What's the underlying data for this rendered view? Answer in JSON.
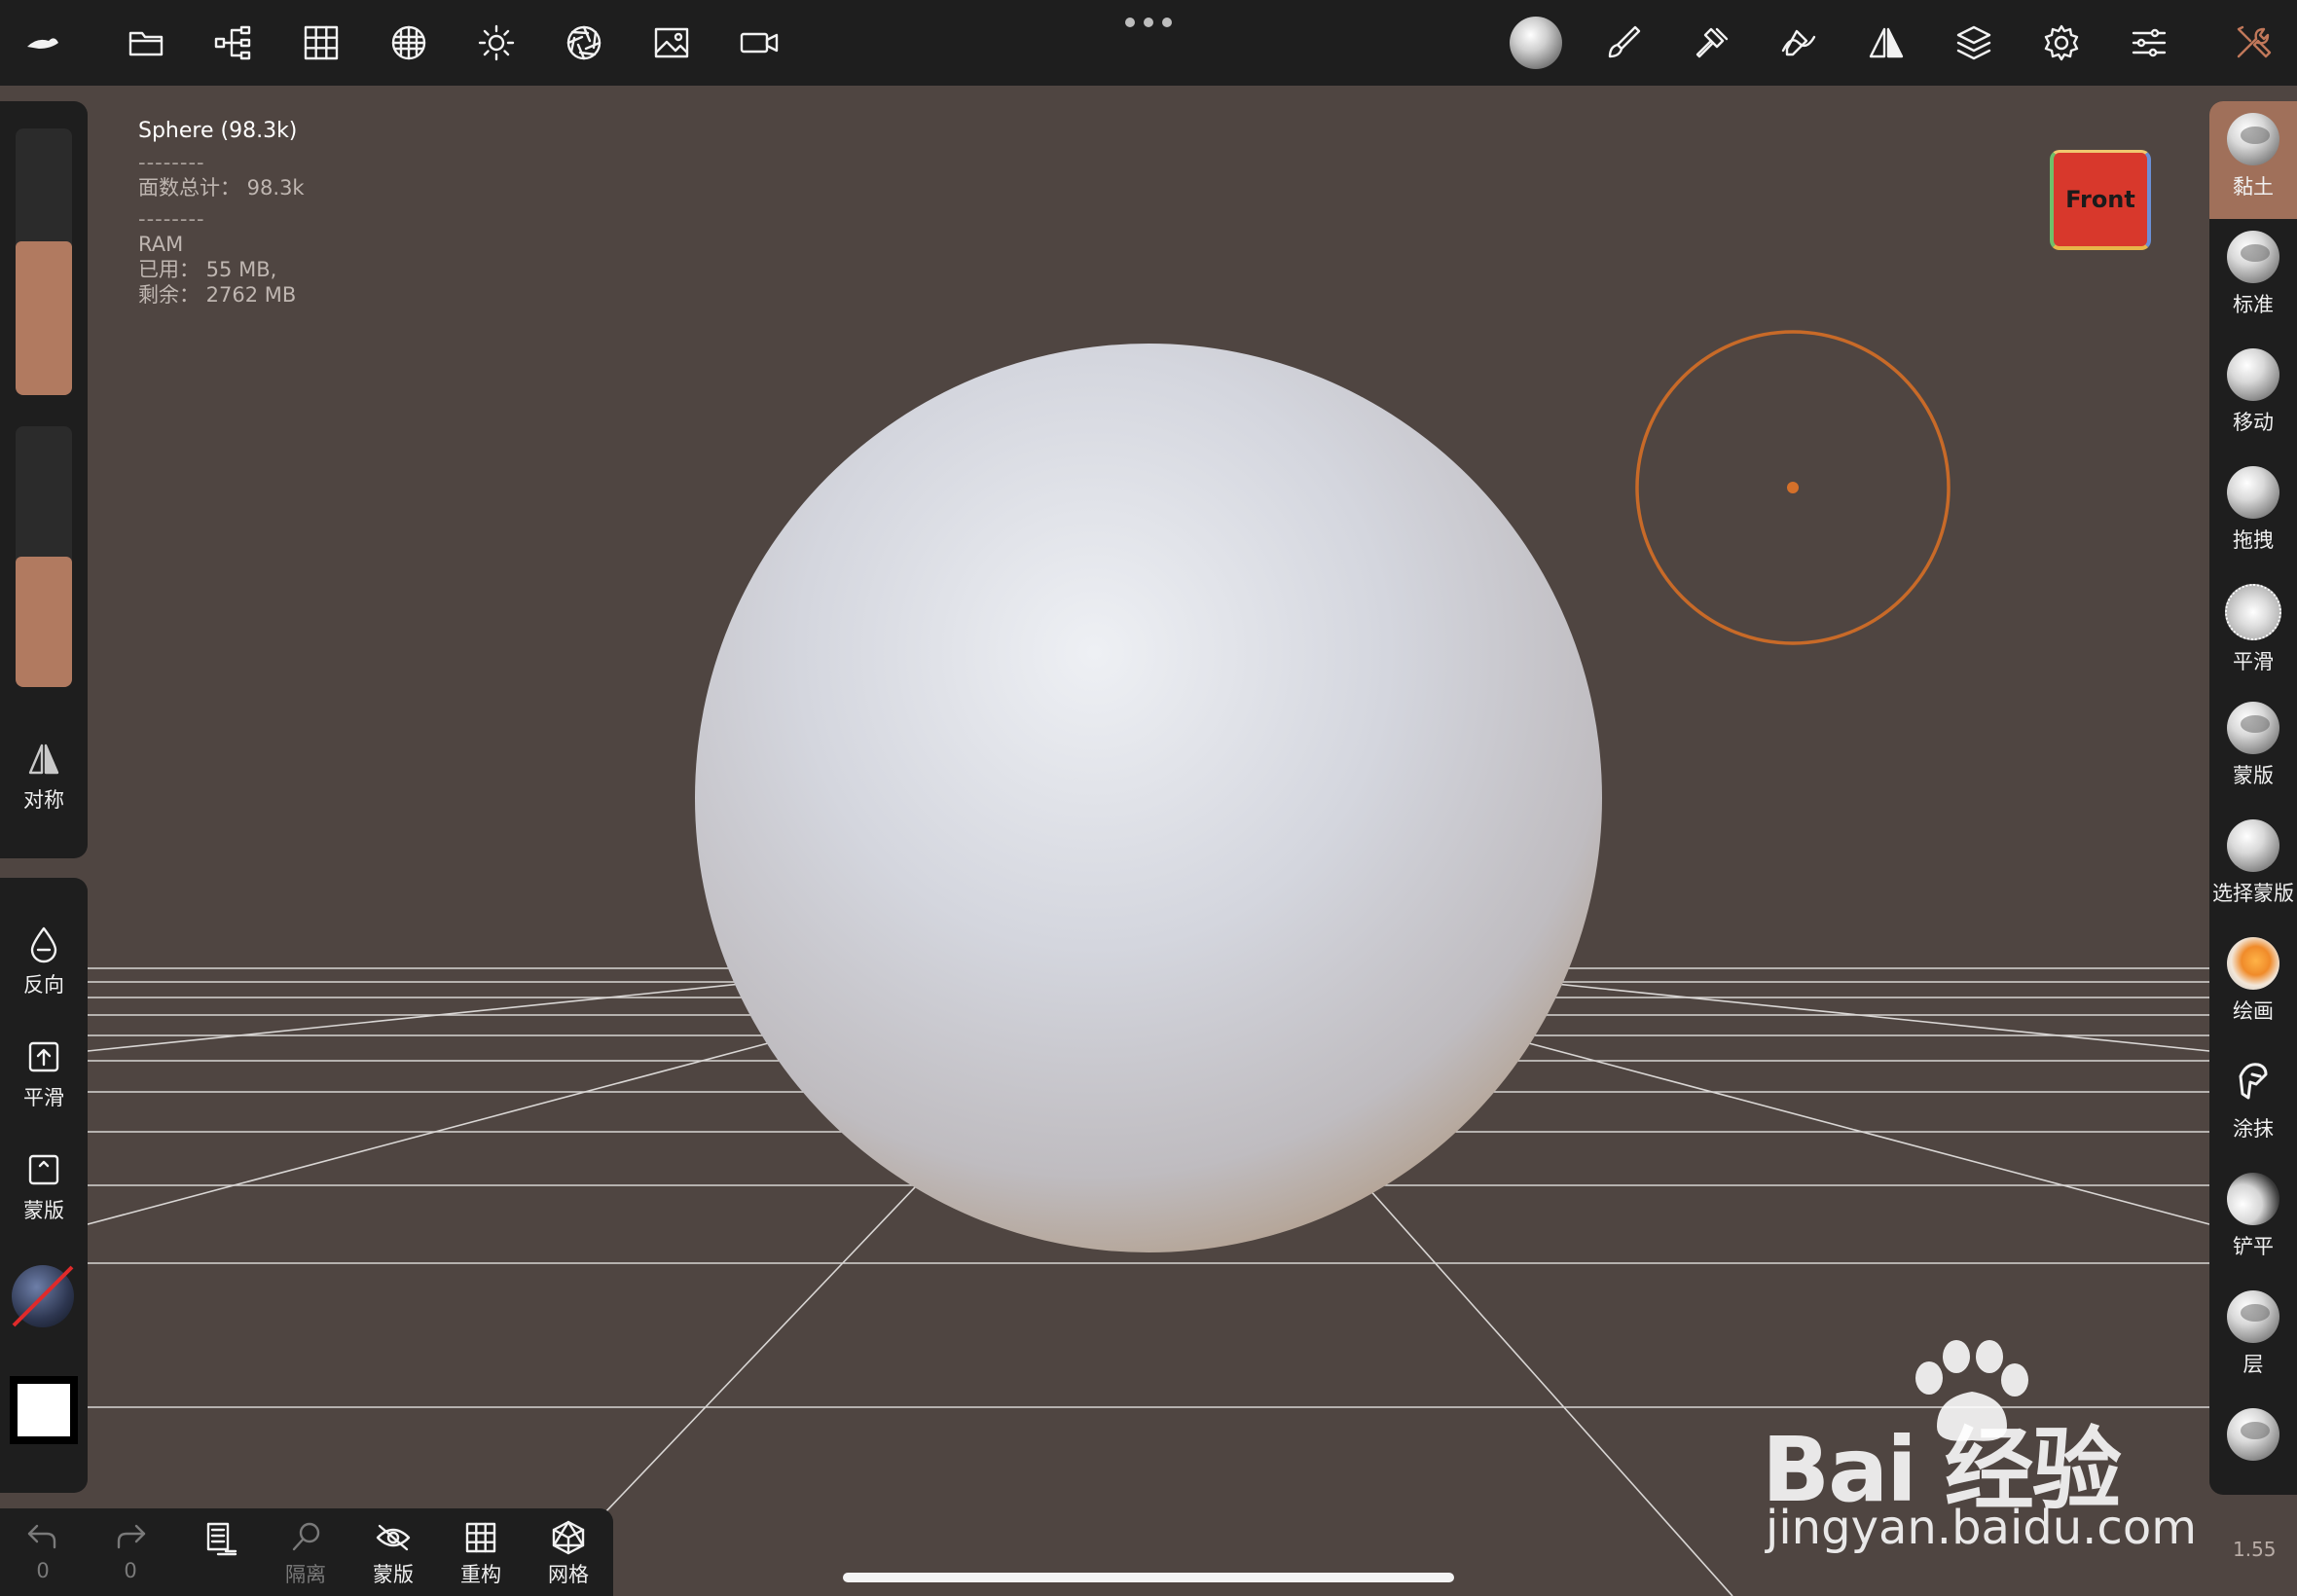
{
  "info": {
    "title": "Sphere (98.3k)",
    "sep": "--------",
    "faces": "面数总计：  98.3k",
    "ram": "RAM",
    "used": "已用：  55 MB,",
    "free": "剩余：  2762 MB"
  },
  "viewcube": {
    "label": "Front"
  },
  "left": {
    "symmetry": "对称",
    "invert": "反向",
    "smooth": "平滑",
    "mask": "蒙版"
  },
  "tools": [
    {
      "label": "黏土"
    },
    {
      "label": "标准"
    },
    {
      "label": "移动"
    },
    {
      "label": "拖拽"
    },
    {
      "label": "平滑"
    },
    {
      "label": "蒙版"
    },
    {
      "label": "选择蒙版"
    },
    {
      "label": "绘画"
    },
    {
      "label": "涂抹"
    },
    {
      "label": "铲平"
    },
    {
      "label": "层"
    }
  ],
  "bottom": {
    "undo_count": "0",
    "redo_count": "0",
    "isolate": "隔离",
    "mask": "蒙版",
    "remesh": "重构",
    "mesh": "网格"
  },
  "zoom": "1.55",
  "watermark": {
    "brand": "Bai   经验",
    "url": "jingyan.baidu.com"
  },
  "colors": {
    "accent": "#b17a60",
    "background": "#4f4541",
    "cursor": "#e07a2a"
  }
}
